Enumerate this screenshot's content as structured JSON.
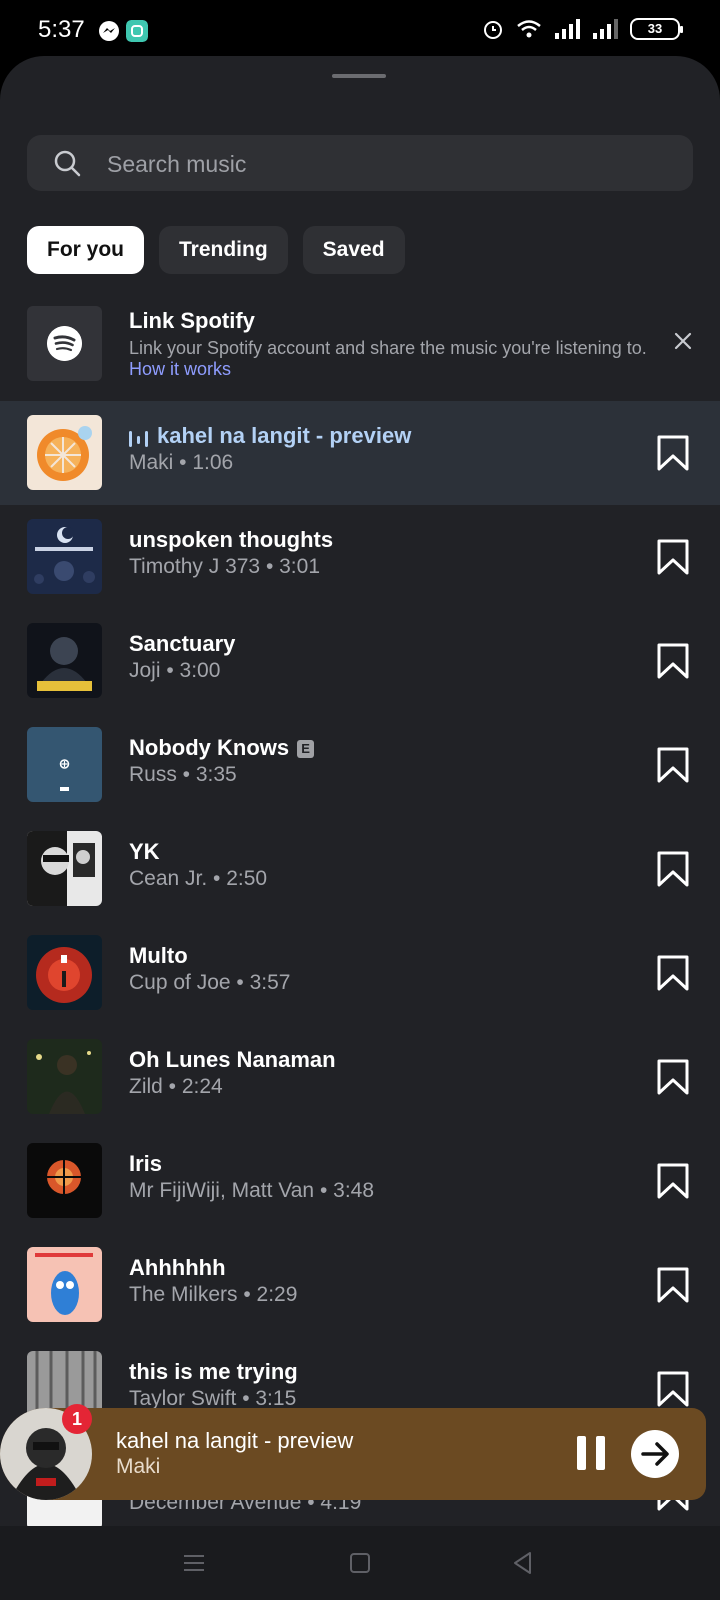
{
  "status": {
    "time": "5:37",
    "battery": "33"
  },
  "search": {
    "placeholder": "Search music"
  },
  "tabs": [
    {
      "label": "For you",
      "active": true
    },
    {
      "label": "Trending",
      "active": false
    },
    {
      "label": "Saved",
      "active": false
    }
  ],
  "spotify": {
    "title": "Link Spotify",
    "description": "Link your Spotify account and share the music you're listening to.",
    "link": "How it works"
  },
  "tracks": [
    {
      "title": "kahel na langit - preview",
      "subtitle": "Maki • 1:06",
      "playing": true
    },
    {
      "title": "unspoken thoughts",
      "subtitle": "Timothy J 373 • 3:01"
    },
    {
      "title": "Sanctuary",
      "subtitle": "Joji • 3:00"
    },
    {
      "title": "Nobody Knows",
      "subtitle": "Russ • 3:35",
      "explicit": "E"
    },
    {
      "title": "YK",
      "subtitle": "Cean Jr. • 2:50"
    },
    {
      "title": "Multo",
      "subtitle": "Cup of Joe • 3:57"
    },
    {
      "title": "Oh Lunes Nanaman",
      "subtitle": "Zild • 2:24"
    },
    {
      "title": "Iris",
      "subtitle": "Mr FijiWiji, Matt Van • 3:48"
    },
    {
      "title": "Ahhhhhh",
      "subtitle": "The Milkers • 2:29"
    },
    {
      "title": "this is me trying",
      "subtitle": "Taylor Swift • 3:15"
    },
    {
      "title": "",
      "subtitle": "December Avenue • 4:19"
    }
  ],
  "player": {
    "title": "kahel na langit - preview",
    "artist": "Maki",
    "badge": "1"
  },
  "colors": {
    "sheet_bg": "#212226",
    "playing_row": "#2c3139",
    "player_bg": "#6b4a22",
    "link": "#8f9dff"
  }
}
